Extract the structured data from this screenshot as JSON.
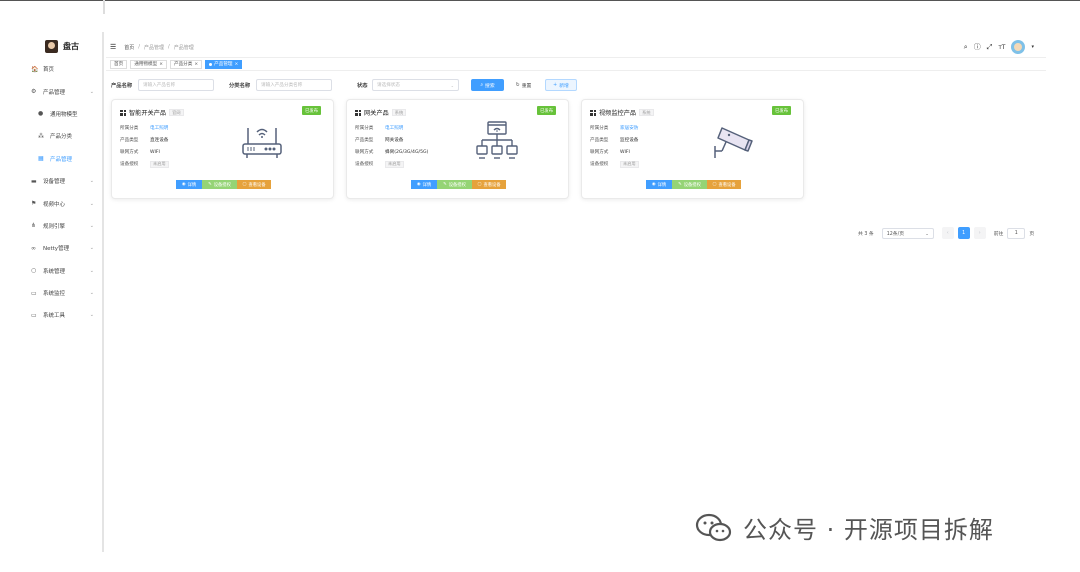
{
  "app": {
    "name": "盘古"
  },
  "sidebar": {
    "items": [
      {
        "label": "首页",
        "icon": "dashboard-icon",
        "glyph": "🏠",
        "expandable": false,
        "sub": false,
        "active": false
      },
      {
        "label": "产品管理",
        "icon": "settings-icon",
        "glyph": "⚙",
        "expandable": true,
        "sub": false,
        "active": false
      },
      {
        "label": "通用物模型",
        "icon": "model-icon",
        "glyph": "●",
        "expandable": false,
        "sub": true,
        "active": false
      },
      {
        "label": "产品分类",
        "icon": "tree-icon",
        "glyph": "⁂",
        "expandable": false,
        "sub": true,
        "active": false
      },
      {
        "label": "产品管理",
        "icon": "grid-icon",
        "glyph": "▦",
        "expandable": false,
        "sub": true,
        "active": true
      },
      {
        "label": "设备管理",
        "icon": "device-icon",
        "glyph": "▬",
        "expandable": true,
        "sub": false,
        "active": false
      },
      {
        "label": "视频中心",
        "icon": "flag-icon",
        "glyph": "⚑",
        "expandable": true,
        "sub": false,
        "active": false
      },
      {
        "label": "规则引擎",
        "icon": "network-icon",
        "glyph": "⋔",
        "expandable": true,
        "sub": false,
        "active": false
      },
      {
        "label": "Netty管理",
        "icon": "link-icon",
        "glyph": "∞",
        "expandable": true,
        "sub": false,
        "active": false
      },
      {
        "label": "系统管理",
        "icon": "system-icon",
        "glyph": "○",
        "expandable": true,
        "sub": false,
        "active": false
      },
      {
        "label": "系统监控",
        "icon": "monitor-icon",
        "glyph": "▭",
        "expandable": true,
        "sub": false,
        "active": false
      },
      {
        "label": "系统工具",
        "icon": "tool-icon",
        "glyph": "▭",
        "expandable": true,
        "sub": false,
        "active": false
      }
    ]
  },
  "header": {
    "breadcrumb": [
      "首页",
      "/",
      "产品管理",
      "/",
      "产品管理"
    ]
  },
  "tags": [
    {
      "label": "首页",
      "active": false,
      "closable": false
    },
    {
      "label": "通用物模型",
      "active": false,
      "closable": true
    },
    {
      "label": "产品分类",
      "active": false,
      "closable": true
    },
    {
      "label": "产品管理",
      "active": true,
      "closable": true
    }
  ],
  "search": {
    "product_name_label": "产品名称",
    "product_name_placeholder": "请输入产品名称",
    "category_label": "分类名称",
    "category_placeholder": "请输入产品分类名称",
    "status_label": "状态",
    "status_placeholder": "请选择状态",
    "search_button": "搜索",
    "reset_button": "重置",
    "add_button": "新增"
  },
  "cards": [
    {
      "name": "智能开关产品",
      "tag": "官网",
      "status": "已发布",
      "fields": [
        {
          "k": "所属分类",
          "v": "电工照明",
          "style": "link"
        },
        {
          "k": "产品类型",
          "v": "直连设备",
          "style": ""
        },
        {
          "k": "联网方式",
          "v": "WIFI",
          "style": ""
        },
        {
          "k": "设备授权",
          "v": "未启用",
          "style": "badge"
        }
      ],
      "image": "router",
      "actions": [
        "详情",
        "设备授权",
        "查看设备"
      ]
    },
    {
      "name": "网关产品",
      "tag": "系统",
      "status": "已发布",
      "fields": [
        {
          "k": "所属分类",
          "v": "电工照明",
          "style": "link"
        },
        {
          "k": "产品类型",
          "v": "网关设备",
          "style": ""
        },
        {
          "k": "联网方式",
          "v": "蜂窝(2G/3G/4G/5G)",
          "style": ""
        },
        {
          "k": "设备授权",
          "v": "未启用",
          "style": "badge"
        }
      ],
      "image": "gateway",
      "actions": [
        "详情",
        "设备授权",
        "查看设备"
      ]
    },
    {
      "name": "视频监控产品",
      "tag": "系统",
      "status": "已发布",
      "fields": [
        {
          "k": "所属分类",
          "v": "家居安防",
          "style": "link"
        },
        {
          "k": "产品类型",
          "v": "监控设备",
          "style": ""
        },
        {
          "k": "联网方式",
          "v": "WIFI",
          "style": ""
        },
        {
          "k": "设备授权",
          "v": "未启用",
          "style": "badge"
        }
      ],
      "image": "camera",
      "actions": [
        "详情",
        "设备授权",
        "查看设备"
      ]
    }
  ],
  "pagination": {
    "total": "共 3 条",
    "page_size": "12条/页",
    "current": "1",
    "goto_label": "前往",
    "goto_value": "1",
    "page_unit": "页"
  },
  "watermark": {
    "text": "公众号 · 开源项目拆解"
  },
  "colors": {
    "primary": "#409eff",
    "success": "#67c23a",
    "warning": "#e6a23c"
  }
}
